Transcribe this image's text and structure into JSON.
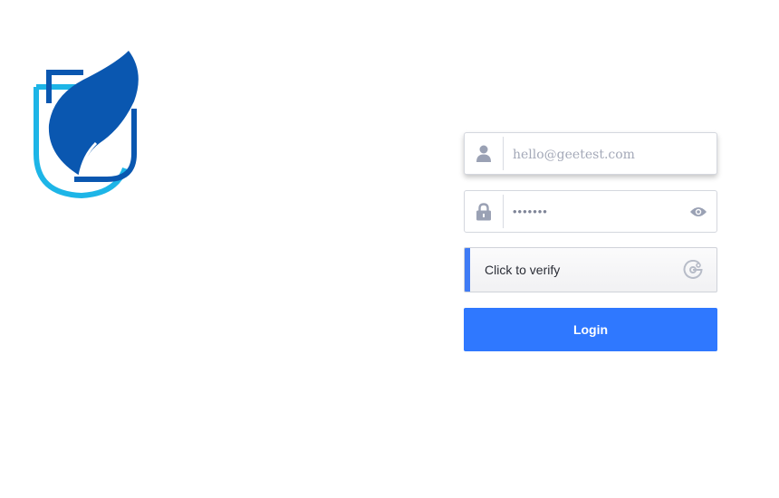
{
  "logo": {
    "name": "brand-logo"
  },
  "form": {
    "email": {
      "placeholder": "hello@geetest.com",
      "value": ""
    },
    "password": {
      "value": "•••••••"
    },
    "verify": {
      "label": "Click to verify"
    },
    "login": {
      "label": "Login"
    }
  },
  "colors": {
    "accent": "#2f78ff",
    "verify_bar": "#3f7bf5",
    "icon_gray": "#9aa1b4",
    "logo_dark": "#0a57b0",
    "logo_light": "#1db5e7"
  },
  "icons": {
    "user": "user-icon",
    "lock": "lock-icon",
    "eye": "eye-icon",
    "verify": "geetest-verify-icon"
  }
}
